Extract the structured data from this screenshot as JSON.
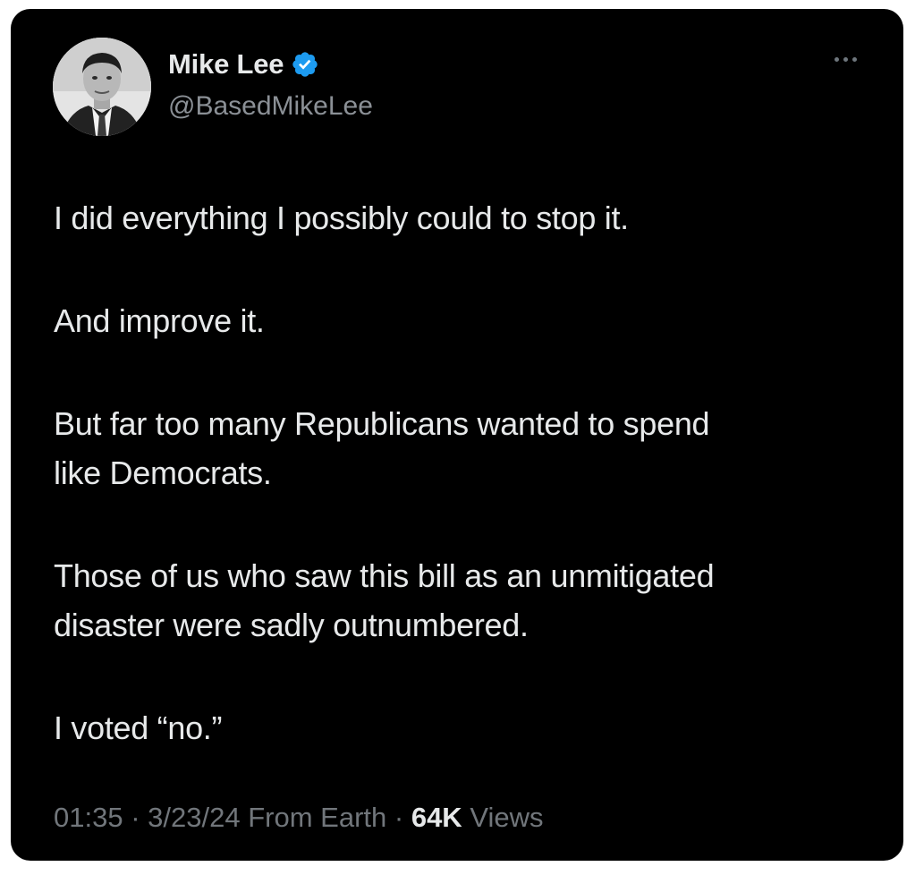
{
  "author": {
    "display_name": "Mike Lee",
    "handle": "@BasedMikeLee",
    "verified_color": "#1d9bf0"
  },
  "tweet": {
    "paragraphs": [
      "I did everything I possibly could to stop it.",
      "And improve it.",
      "But far too many Republicans wanted to spend\nlike Democrats.",
      "Those of us who saw this bill as an unmitigated\ndisaster were sadly outnumbered.",
      "I voted “no.”"
    ]
  },
  "meta": {
    "time": "01:35",
    "separator": "·",
    "date": "3/23/24",
    "source": "From Earth",
    "views_count": "64K",
    "views_label": "Views"
  },
  "icons": {
    "verified": "verified-badge-icon",
    "more": "more-options-icon"
  }
}
